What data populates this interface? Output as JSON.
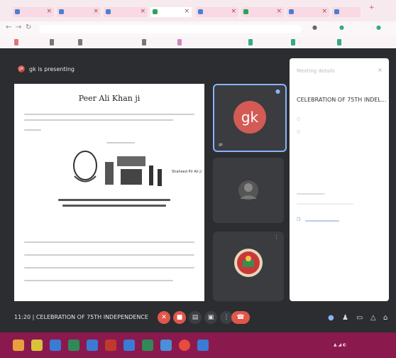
{
  "meet": {
    "presenting_label": "gk is presenting",
    "presenter_initials": "gk",
    "presenter_tile_name": "gk",
    "tile_names": [
      "gk",
      "",
      ""
    ],
    "meeting_time": "11:20",
    "meeting_name": "CELEBRATION OF 75TH INDEPENDENCE"
  },
  "slide": {
    "title": "Peer Ali Khan ji",
    "caption": "Shaheed Pir Ali ji"
  },
  "panel": {
    "header": "Meeting details",
    "meeting_title": "CELEBRATION OF 75TH INDEL...",
    "close_glyph": "×"
  },
  "colors": {
    "meet_bg": "#2b2d31",
    "avatar_red": "#d35a55",
    "control_red": "#e0574a",
    "taskbar": "#8a1a4e"
  },
  "icons": [
    "mic-off-icon",
    "camera-off-icon",
    "captions-icon",
    "present-icon",
    "more-icon",
    "end-call-icon",
    "info-icon",
    "people-icon",
    "chat-icon",
    "activities-icon",
    "lock-icon"
  ]
}
